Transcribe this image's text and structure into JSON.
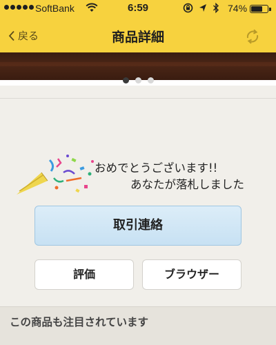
{
  "status_bar": {
    "carrier": "SoftBank",
    "time": "6:59",
    "battery_percent": "74%",
    "battery_level": 0.74
  },
  "nav": {
    "back_label": "戻る",
    "title": "商品詳細",
    "refresh_icon": "refresh-icon"
  },
  "carousel": {
    "page_count": 3,
    "active_index": 0
  },
  "notice": {
    "line1": "おめでとうございます!!",
    "line2": "あなたが落札しました",
    "icon": "party-popper-icon"
  },
  "actions": {
    "contact_label": "取引連絡",
    "evaluate_label": "評価",
    "browser_label": "ブラウザー"
  },
  "section": {
    "title": "この商品も注目されています"
  },
  "colors": {
    "header": "#f7d23e",
    "primary_button": "#c7e1f3",
    "background": "#f1efea"
  }
}
